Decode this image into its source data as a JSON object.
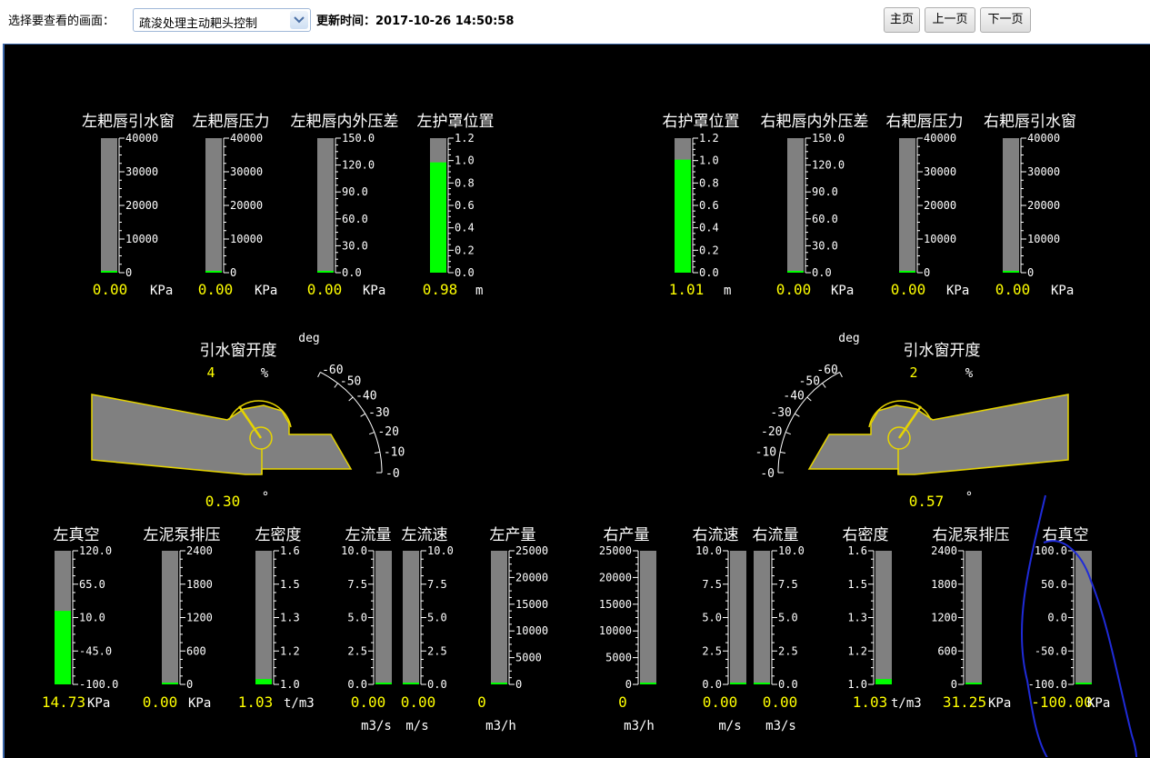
{
  "toolbar": {
    "select_label": "选择要查看的画面：",
    "select_value": "疏浚处理主动耙头控制",
    "update_label": "更新时间：",
    "update_time": "2017-10-26 14:50:58",
    "buttons": {
      "home": "主页",
      "prev": "上一页",
      "next": "下一页"
    }
  },
  "colors": {
    "background": "#000000",
    "bar_track": "#808080",
    "bar_fill": "#00ff00",
    "value_text": "#ffff00",
    "label_text": "#ffffff",
    "outline": "#e6d400",
    "annotation": "#1f2bd8"
  },
  "top_gauges": [
    {
      "label": "左耙唇引水窗",
      "value": "0.00",
      "unit": "KPa",
      "level": 0,
      "ticks": [
        "40000",
        "30000",
        "20000",
        "10000",
        "0"
      ],
      "tick_side": "right"
    },
    {
      "label": "左耙唇压力",
      "value": "0.00",
      "unit": "KPa",
      "level": 0,
      "ticks": [
        "40000",
        "30000",
        "20000",
        "10000",
        "0"
      ],
      "tick_side": "right"
    },
    {
      "label": "左耙唇内外压差",
      "value": "0.00",
      "unit": "KPa",
      "level": 0,
      "ticks": [
        "150.0",
        "120.0",
        "90.0",
        "60.0",
        "30.0",
        "0.0"
      ],
      "tick_side": "right"
    },
    {
      "label": "左护罩位置",
      "value": "0.98",
      "unit": "m",
      "level": 0.82,
      "ticks": [
        "1.2",
        "1.0",
        "0.8",
        "0.6",
        "0.4",
        "0.2",
        "0.0"
      ],
      "tick_side": "right"
    },
    {
      "label": "右护罩位置",
      "value": "1.01",
      "unit": "m",
      "level": 0.84,
      "ticks": [
        "1.2",
        "1.0",
        "0.8",
        "0.6",
        "0.4",
        "0.2",
        "0.0"
      ],
      "tick_side": "right"
    },
    {
      "label": "右耙唇内外压差",
      "value": "0.00",
      "unit": "KPa",
      "level": 0,
      "ticks": [
        "150.0",
        "120.0",
        "90.0",
        "60.0",
        "30.0",
        "0.0"
      ],
      "tick_side": "right"
    },
    {
      "label": "右耙唇压力",
      "value": "0.00",
      "unit": "KPa",
      "level": 0,
      "ticks": [
        "40000",
        "30000",
        "20000",
        "10000",
        "0"
      ],
      "tick_side": "right"
    },
    {
      "label": "右耙唇引水窗",
      "value": "0.00",
      "unit": "KPa",
      "level": 0,
      "ticks": [
        "40000",
        "30000",
        "20000",
        "10000",
        "0"
      ],
      "tick_side": "right"
    }
  ],
  "dragheads": {
    "left": {
      "window_label": "引水窗开度",
      "window_value": "4",
      "window_unit": "%",
      "angle_value": "0.30",
      "angle_unit": "°",
      "dial_unit": "deg",
      "dial_ticks": [
        "-60",
        "-50",
        "-40",
        "-30",
        "-20",
        "-10",
        "-0"
      ]
    },
    "right": {
      "window_label": "引水窗开度",
      "window_value": "2",
      "window_unit": "%",
      "angle_value": "0.57",
      "angle_unit": "°",
      "dial_unit": "deg",
      "dial_ticks": [
        "-60",
        "-50",
        "-40",
        "-30",
        "-20",
        "-10",
        "-0"
      ]
    }
  },
  "bottom_gauges": [
    {
      "label": "左真空",
      "value": "14.73",
      "unit": "KPa",
      "unit2": "",
      "level": 0.55,
      "ticks": [
        "120.0",
        "65.0",
        "10.0",
        "-45.0",
        "-100.0"
      ],
      "tick_side": "right"
    },
    {
      "label": "左泥泵排压",
      "value": "0.00",
      "unit": "KPa",
      "unit2": "",
      "level": 0,
      "ticks": [
        "2400",
        "1800",
        "1200",
        "600",
        "0"
      ],
      "tick_side": "right"
    },
    {
      "label": "左密度",
      "value": "1.03",
      "unit": "t/m3",
      "unit2": "",
      "level": 0.04,
      "ticks": [
        "1.6",
        "1.5",
        "1.3",
        "1.2",
        "1.0"
      ],
      "tick_side": "right"
    },
    {
      "label": "左流量",
      "value": "0.00",
      "unit": "",
      "unit2": "m3/s",
      "level": 0,
      "ticks": [
        "10.0",
        "7.5",
        "5.0",
        "2.5",
        "0.0"
      ],
      "tick_side": "left"
    },
    {
      "label": "左流速",
      "value": "0.00",
      "unit": "",
      "unit2": "m/s",
      "level": 0,
      "ticks": [
        "10.0",
        "7.5",
        "5.0",
        "2.5",
        "0.0"
      ],
      "tick_side": "right"
    },
    {
      "label": "左产量",
      "value": "0",
      "unit": "",
      "unit2": "m3/h",
      "level": 0,
      "ticks": [
        "25000",
        "20000",
        "15000",
        "10000",
        "5000",
        "0"
      ],
      "tick_side": "right"
    },
    {
      "label": "右产量",
      "value": "0",
      "unit": "",
      "unit2": "m3/h",
      "level": 0,
      "ticks": [
        "25000",
        "20000",
        "15000",
        "10000",
        "5000",
        "0"
      ],
      "tick_side": "left"
    },
    {
      "label": "右流速",
      "value": "0.00",
      "unit": "",
      "unit2": "m/s",
      "level": 0,
      "ticks": [
        "10.0",
        "7.5",
        "5.0",
        "2.5",
        "0.0"
      ],
      "tick_side": "left"
    },
    {
      "label": "右流量",
      "value": "0.00",
      "unit": "",
      "unit2": "m3/s",
      "level": 0,
      "ticks": [
        "10.0",
        "7.5",
        "5.0",
        "2.5",
        "0.0"
      ],
      "tick_side": "right"
    },
    {
      "label": "右密度",
      "value": "1.03",
      "unit": "t/m3",
      "unit2": "",
      "level": 0.04,
      "ticks": [
        "1.6",
        "1.5",
        "1.3",
        "1.2",
        "1.0"
      ],
      "tick_side": "left"
    },
    {
      "label": "右泥泵排压",
      "value": "31.25",
      "unit": "KPa",
      "unit2": "",
      "level": 0,
      "ticks": [
        "2400",
        "1800",
        "1200",
        "600",
        "0"
      ],
      "tick_side": "left"
    },
    {
      "label": "右真空",
      "value": "-100.00",
      "unit": "KPa",
      "unit2": "",
      "level": 0,
      "ticks": [
        "100.0",
        "50.0",
        "0.0",
        "-50.0",
        "-100.0"
      ],
      "tick_side": "left"
    }
  ]
}
